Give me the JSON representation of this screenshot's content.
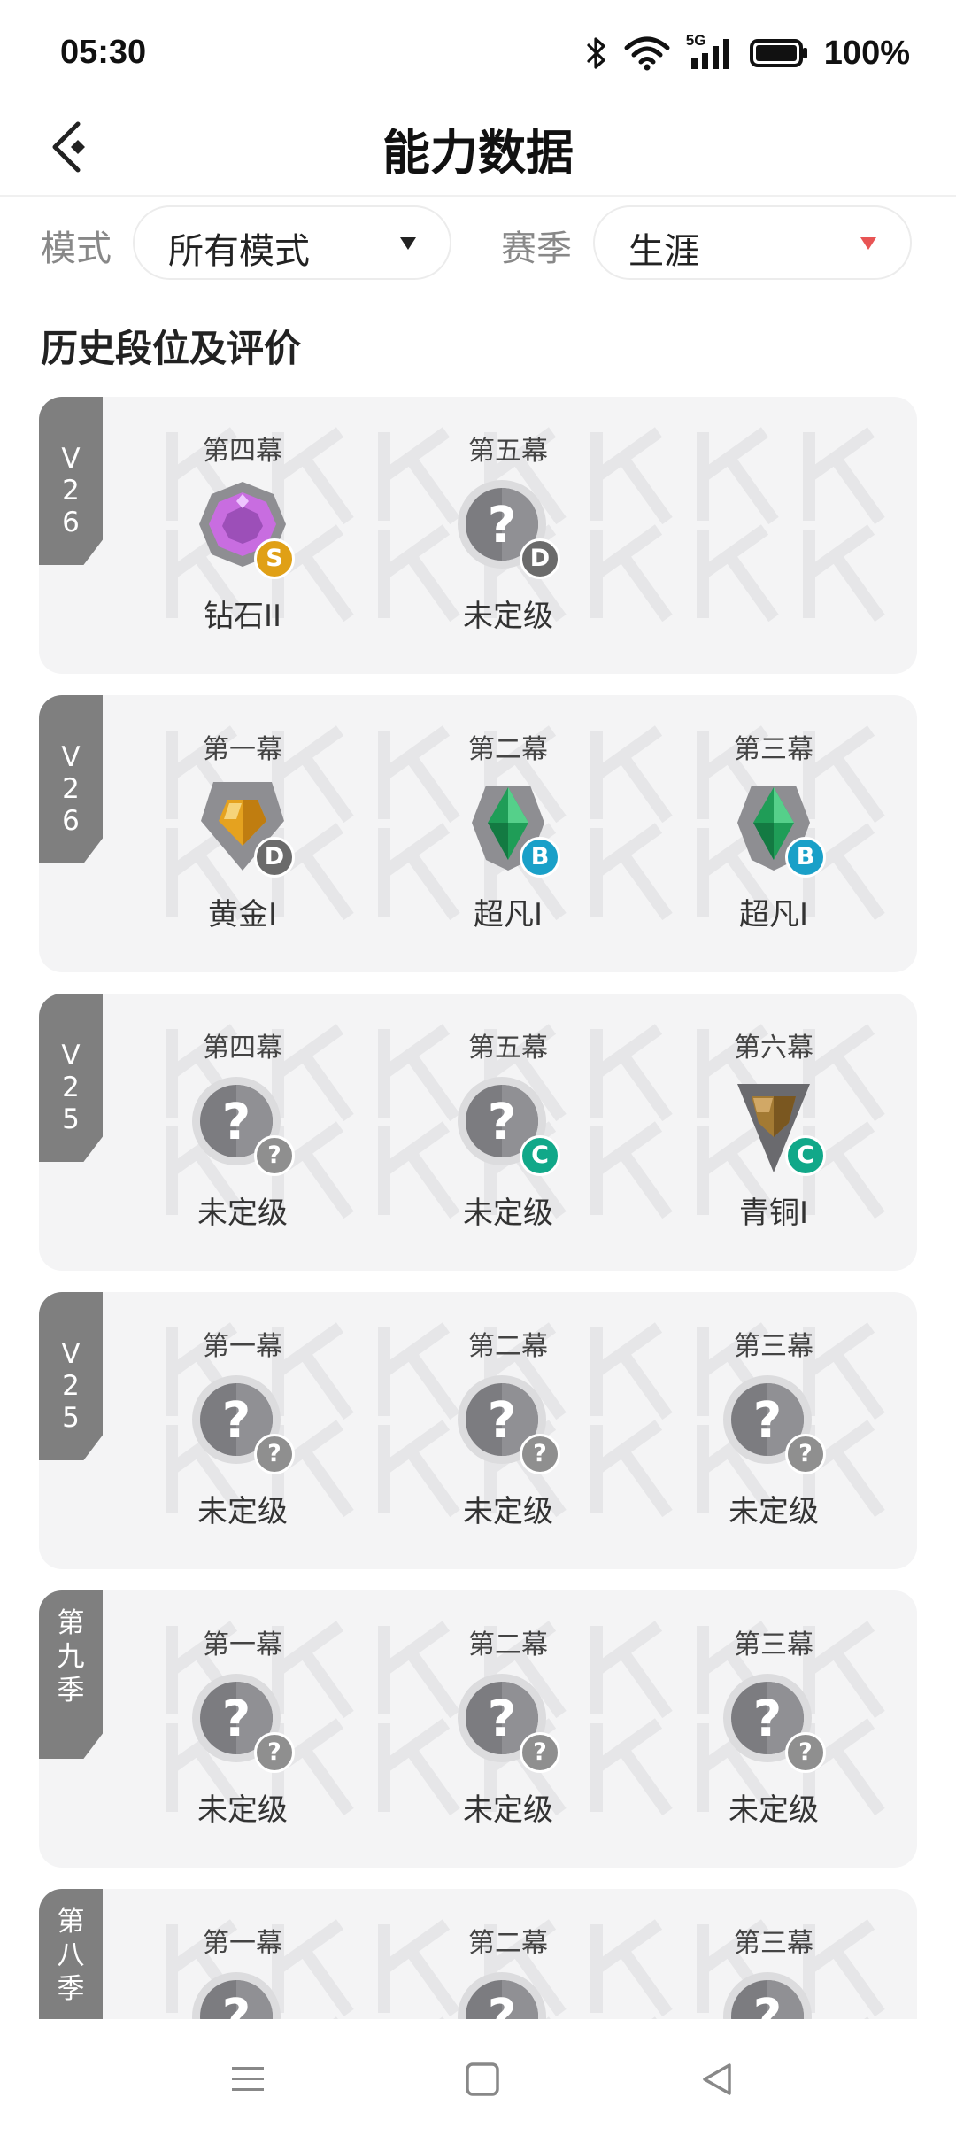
{
  "status": {
    "time": "05:30",
    "network": "5G",
    "battery": "100%"
  },
  "header": {
    "title": "能力数据"
  },
  "filters": {
    "mode_label": "模式",
    "mode_value": "所有模式",
    "season_label": "赛季",
    "season_value": "生涯"
  },
  "section_title": "历史段位及评价",
  "colors": {
    "card_bg": "#f4f4f5",
    "tag_bg": "#7f7f7f",
    "grade_S": "#e0a016",
    "grade_D": "#6b6b6b",
    "grade_B": "#1aa0c8",
    "grade_C": "#11a889",
    "grade_unknown": "#8f8f8f",
    "accent_caret": "#e85454"
  },
  "cards": [
    {
      "tag": "V 26",
      "acts": [
        {
          "name": "第四幕",
          "rank": "钻石II",
          "icon": "diamond-rank-icon",
          "grade": "S"
        },
        {
          "name": "第五幕",
          "rank": "未定级",
          "icon": "unranked-icon",
          "grade": "D"
        }
      ]
    },
    {
      "tag": "V 26",
      "acts": [
        {
          "name": "第一幕",
          "rank": "黄金I",
          "icon": "gold-rank-icon",
          "grade": "D"
        },
        {
          "name": "第二幕",
          "rank": "超凡I",
          "icon": "ascendant-rank-icon",
          "grade": "B"
        },
        {
          "name": "第三幕",
          "rank": "超凡I",
          "icon": "ascendant-rank-icon",
          "grade": "B"
        }
      ]
    },
    {
      "tag": "V 25",
      "acts": [
        {
          "name": "第四幕",
          "rank": "未定级",
          "icon": "unranked-icon",
          "grade": "?"
        },
        {
          "name": "第五幕",
          "rank": "未定级",
          "icon": "unranked-icon",
          "grade": "C"
        },
        {
          "name": "第六幕",
          "rank": "青铜I",
          "icon": "bronze-rank-icon",
          "grade": "C"
        }
      ]
    },
    {
      "tag": "V 25",
      "acts": [
        {
          "name": "第一幕",
          "rank": "未定级",
          "icon": "unranked-icon",
          "grade": "?"
        },
        {
          "name": "第二幕",
          "rank": "未定级",
          "icon": "unranked-icon",
          "grade": "?"
        },
        {
          "name": "第三幕",
          "rank": "未定级",
          "icon": "unranked-icon",
          "grade": "?"
        }
      ]
    },
    {
      "tag": "第九季",
      "acts": [
        {
          "name": "第一幕",
          "rank": "未定级",
          "icon": "unranked-icon",
          "grade": "?"
        },
        {
          "name": "第二幕",
          "rank": "未定级",
          "icon": "unranked-icon",
          "grade": "?"
        },
        {
          "name": "第三幕",
          "rank": "未定级",
          "icon": "unranked-icon",
          "grade": "?"
        }
      ]
    },
    {
      "tag": "第八季",
      "acts": [
        {
          "name": "第一幕",
          "rank": "",
          "icon": "unranked-icon",
          "grade": ""
        },
        {
          "name": "第二幕",
          "rank": "",
          "icon": "unranked-icon",
          "grade": ""
        },
        {
          "name": "第三幕",
          "rank": "",
          "icon": "unranked-icon",
          "grade": ""
        }
      ]
    }
  ],
  "nav": {
    "menu_icon": "menu-icon",
    "home_icon": "home-square-icon",
    "back_icon": "back-triangle-icon"
  }
}
